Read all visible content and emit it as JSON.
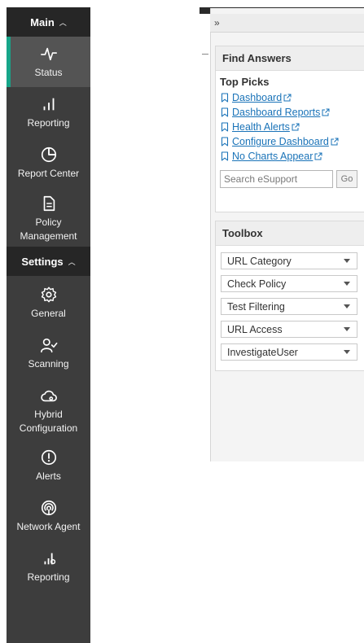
{
  "sidebar": {
    "main_section": {
      "label": "Main"
    },
    "main_items": [
      {
        "label": "Status",
        "icon": "activity-icon",
        "active": true
      },
      {
        "label": "Reporting",
        "icon": "bar-chart-icon"
      },
      {
        "label": "Report Center",
        "icon": "pie-chart-icon"
      },
      {
        "label": "Policy Management",
        "label_lines": [
          "Policy",
          "Management"
        ],
        "icon": "document-icon"
      }
    ],
    "settings_section": {
      "label": "Settings"
    },
    "settings_items": [
      {
        "label": "General",
        "icon": "gear-icon"
      },
      {
        "label": "Scanning",
        "icon": "user-check-icon"
      },
      {
        "label": "Hybrid Configuration",
        "label_lines": [
          "Hybrid",
          "Configuration"
        ],
        "icon": "cloud-gear-icon"
      },
      {
        "label": "Alerts",
        "icon": "alert-circle-icon"
      },
      {
        "label": "Network Agent",
        "icon": "network-agent-icon"
      },
      {
        "label": "Reporting",
        "icon": "reporting-chart-icon"
      }
    ],
    "colors": {
      "background": "#3d3d3d",
      "header": "#262626",
      "active_accent": "#17a589"
    }
  },
  "panel": {
    "collapse_glyph": "»",
    "find_answers": {
      "title": "Find Answers",
      "top_picks_label": "Top Picks",
      "links": [
        "Dashboard",
        "Dashboard Reports",
        "Health Alerts",
        "Configure Dashboard",
        "No Charts Appear"
      ],
      "search_placeholder": "Search eSupport",
      "go_label": "Go"
    },
    "toolbox": {
      "title": "Toolbox",
      "selects": [
        "URL Category",
        "Check Policy",
        "Test Filtering",
        "URL Access",
        "InvestigateUser"
      ]
    },
    "colors": {
      "link": "#1a73b8"
    }
  }
}
